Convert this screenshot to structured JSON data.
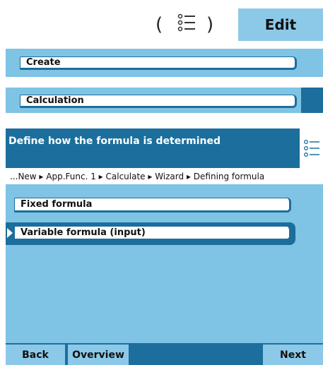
{
  "header": {
    "edit_label": "Edit"
  },
  "menu": {
    "create_label": "Create",
    "calculation_label": "Calculation"
  },
  "panel": {
    "title": "Define how the formula is determined",
    "breadcrumb": "...New ▸ App.Func. 1 ▸ Calculate ▸ Wizard ▸ Defining formula",
    "options": [
      {
        "label": "Fixed formula",
        "selected": false
      },
      {
        "label": "Variable formula (input)",
        "selected": true
      }
    ]
  },
  "footer": {
    "back_label": "Back",
    "overview_label": "Overview",
    "next_label": "Next"
  },
  "colors": {
    "accent_dark": "#1c6e9c",
    "accent_light": "#7fc3e5",
    "button_light": "#8cc9e8"
  }
}
